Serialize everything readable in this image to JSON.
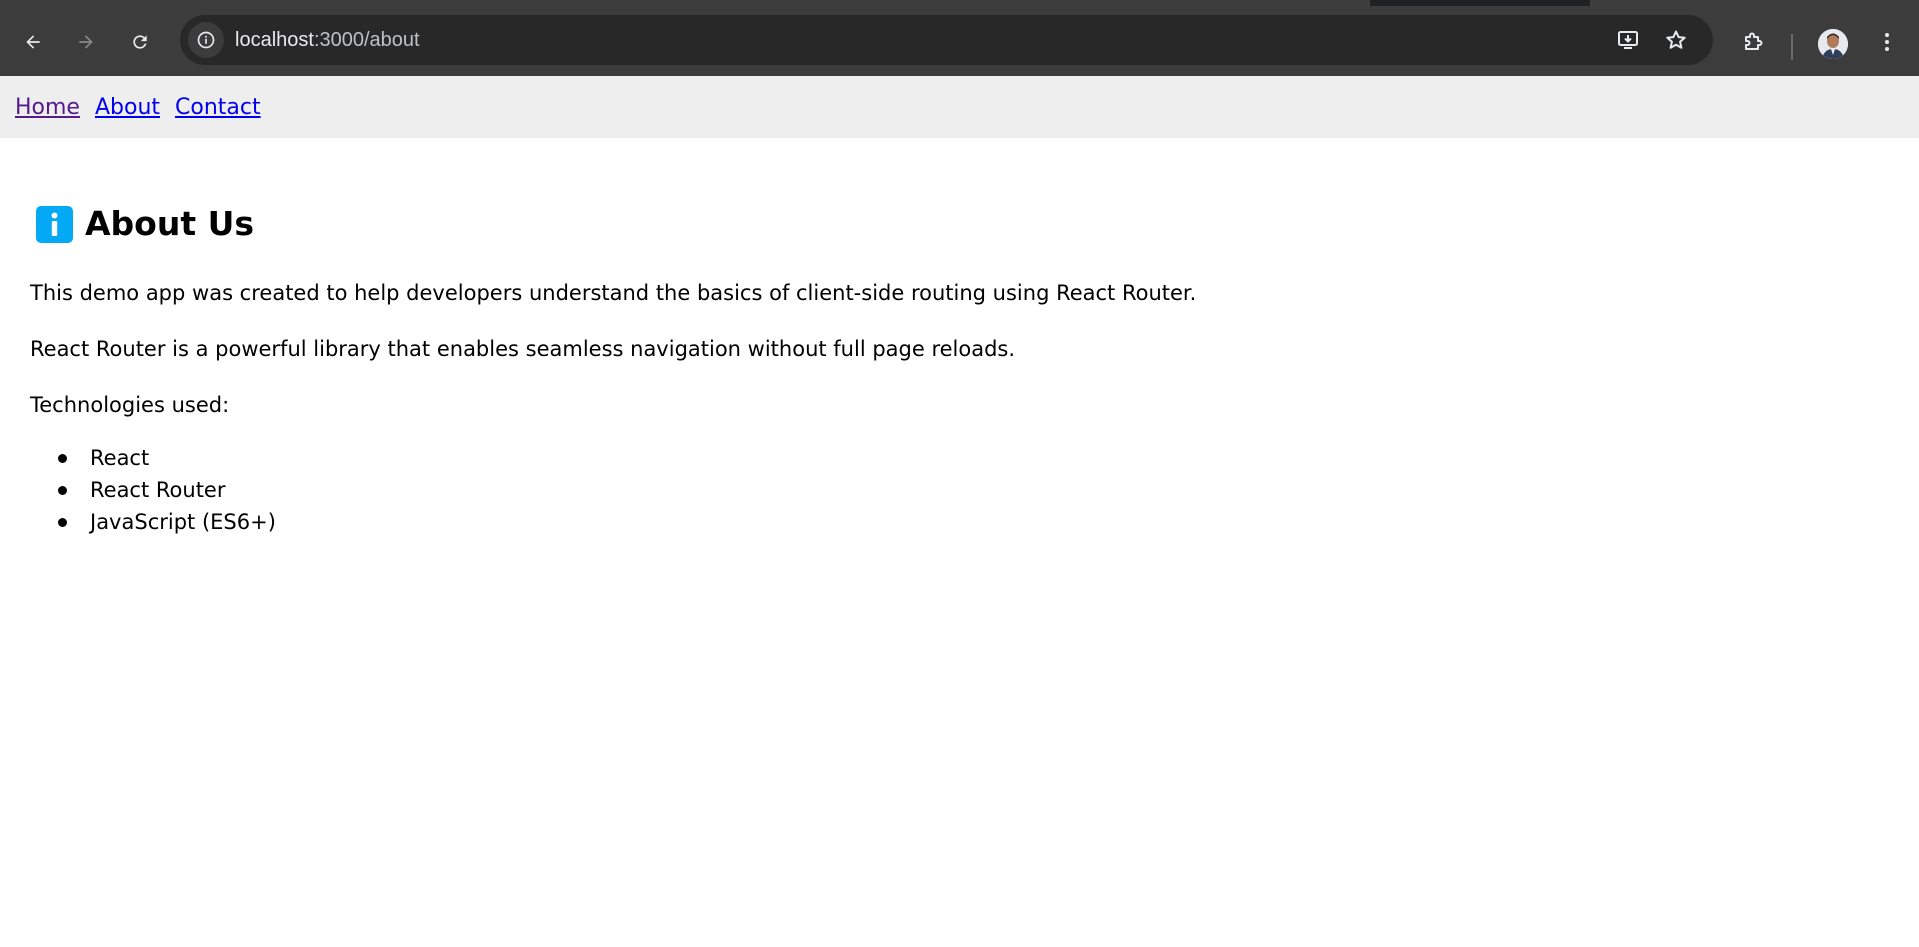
{
  "browser": {
    "url_host": "localhost",
    "url_path": ":3000/about",
    "icons": {
      "back": "arrow-left-icon",
      "forward": "arrow-right-icon",
      "reload": "reload-icon",
      "site_info": "info-circle-icon",
      "install": "install-app-icon",
      "bookmark": "star-icon",
      "extensions": "puzzle-icon",
      "menu": "kebab-menu-icon"
    }
  },
  "app_nav": {
    "links": [
      "Home",
      "About",
      "Contact"
    ]
  },
  "page": {
    "heading": "About Us",
    "heading_icon": "information-emoji",
    "paragraph_1": "This demo app was created to help developers understand the basics of client-side routing using React Router.",
    "paragraph_2": "React Router is a powerful library that enables seamless navigation without full page reloads.",
    "paragraph_3": "Technologies used:",
    "technologies": [
      "React",
      "React Router",
      "JavaScript (ES6+)"
    ]
  },
  "colors": {
    "chrome": "#3c3c3c",
    "omnibox": "#282828",
    "link": "#0000ee",
    "link_visited": "#551a8b",
    "nav_bg": "#eeeeee",
    "info_blue": "#03a9f4"
  }
}
